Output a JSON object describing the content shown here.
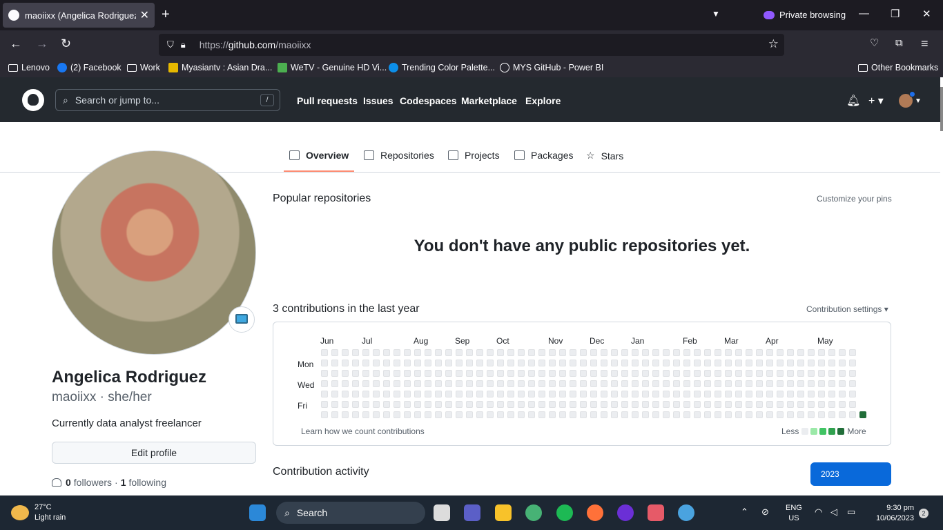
{
  "browser": {
    "tab_title": "maoiixx (Angelica Rodriguez)",
    "private_label": "Private browsing",
    "url_scheme": "https://",
    "url_host": "github.com",
    "url_path": "/maoiixx",
    "bookmarks": [
      {
        "label": "Lenovo",
        "icon": "folder-icon"
      },
      {
        "label": "(2) Facebook",
        "icon": "facebook-icon",
        "color": "#1877f2"
      },
      {
        "label": "Work",
        "icon": "folder-icon"
      },
      {
        "label": "Myasiantv : Asian Dra...",
        "icon": "myasiantv-icon",
        "color": "#e6b800"
      },
      {
        "label": "WeTV - Genuine HD Vi...",
        "icon": "wetv-icon",
        "color": "#4caf50"
      },
      {
        "label": "Trending Color Palette...",
        "icon": "coolors-icon",
        "color": "#0c8ee8"
      },
      {
        "label": "MYS GitHub - Power BI",
        "icon": "globe-icon"
      }
    ],
    "other_bookmarks": "Other Bookmarks"
  },
  "github": {
    "search_placeholder": "Search or jump to...",
    "search_key": "/",
    "nav": [
      "Pull requests",
      "Issues",
      "Codespaces",
      "Marketplace",
      "Explore"
    ],
    "tabs": [
      {
        "label": "Overview",
        "icon": "book-icon",
        "active": true
      },
      {
        "label": "Repositories",
        "icon": "repo-icon"
      },
      {
        "label": "Projects",
        "icon": "table-icon"
      },
      {
        "label": "Packages",
        "icon": "package-icon"
      },
      {
        "label": "Stars",
        "icon": "star-icon"
      }
    ]
  },
  "profile": {
    "name": "Angelica Rodriguez",
    "username_line": "maoiixx · she/her",
    "bio": "Currently data analyst freelancer",
    "edit_label": "Edit profile",
    "followers_count": "0",
    "followers_label": "followers",
    "separator": "·",
    "following_count": "1",
    "following_label": "following"
  },
  "main": {
    "popular_title": "Popular repositories",
    "customize_pins": "Customize your pins",
    "no_repos": "You don't have any public repositories yet.",
    "contrib_title": "3 contributions in the last year",
    "contrib_settings": "Contribution settings ▾",
    "months": [
      "Jun",
      "Jul",
      "Aug",
      "Sep",
      "Oct",
      "Nov",
      "Dec",
      "Jan",
      "Feb",
      "Mar",
      "Apr",
      "May"
    ],
    "days": [
      "Mon",
      "Wed",
      "Fri"
    ],
    "learn_link": "Learn how we count contributions",
    "legend_less": "Less",
    "legend_more": "More",
    "legend_colors": [
      "#ebedf0",
      "#9be9a8",
      "#40c463",
      "#30a14e",
      "#216e39"
    ],
    "grid_weeks": 53,
    "active_color": "#216e39",
    "activity_title": "Contribution activity",
    "year_button": "2023"
  },
  "taskbar": {
    "temp": "27°C",
    "condition": "Light rain",
    "search_label": "Search",
    "lang_top": "ENG",
    "lang_bottom": "US",
    "time": "9:30 pm",
    "date": "10/06/2023",
    "notifications": "2"
  }
}
